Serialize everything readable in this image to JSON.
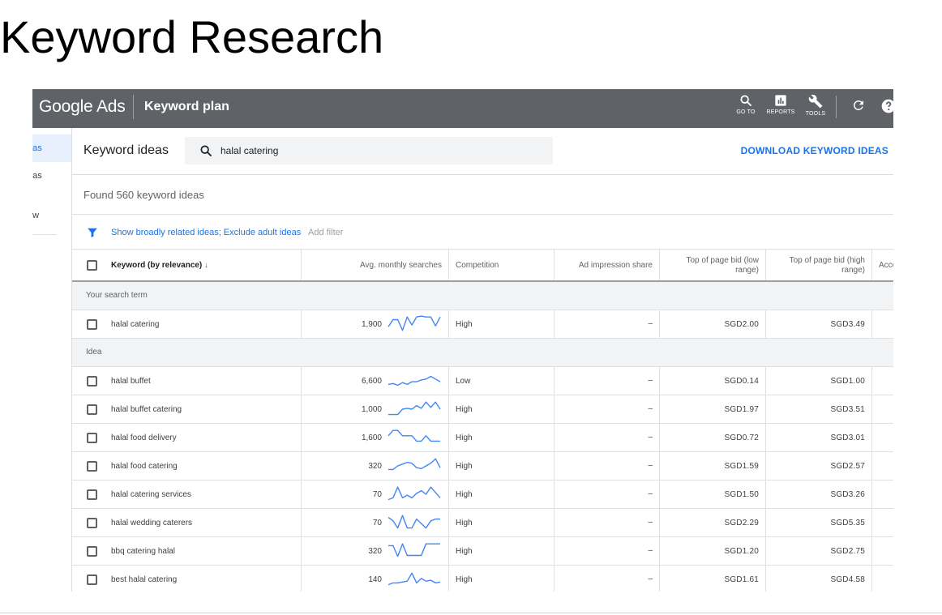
{
  "slide": {
    "title": "Keyword Research"
  },
  "topbar": {
    "brand": "Google Ads",
    "page": "Keyword plan",
    "buttons": [
      {
        "label": "GO TO",
        "icon": "search-icon"
      },
      {
        "label": "REPORTS",
        "icon": "reports-icon"
      },
      {
        "label": "TOOLS",
        "icon": "wrench-icon"
      }
    ],
    "icons": [
      "refresh-icon",
      "help-icon"
    ]
  },
  "nav": {
    "items": [
      "eas",
      "eas",
      "ew"
    ]
  },
  "header": {
    "title": "Keyword ideas",
    "search_value": "halal catering",
    "download": "DOWNLOAD KEYWORD IDEAS"
  },
  "found": "Found 560 keyword ideas",
  "filters": {
    "links": "Show broadly related ideas; Exclude adult ideas",
    "add": "Add filter"
  },
  "table": {
    "columns": {
      "keyword": "Keyword (by relevance)",
      "avg": "Avg. monthly searches",
      "competition": "Competition",
      "impression": "Ad impression share",
      "low_1": "Top of page bid (low",
      "low_2": "range)",
      "high_1": "Top of page bid (high",
      "high_2": "range)",
      "acc": "Acco"
    },
    "groups": {
      "search": "Your search term",
      "idea": "Idea"
    },
    "search_rows": [
      {
        "keyword": "halal catering",
        "searches": "1,900",
        "competition": "High",
        "impression": "–",
        "low": "SGD2.00",
        "high": "SGD3.49",
        "trend": [
          0.35,
          0.75,
          0.75,
          0.15,
          0.9,
          0.45,
          0.9,
          0.95,
          0.9,
          0.9,
          0.4,
          0.9
        ]
      }
    ],
    "idea_rows": [
      {
        "keyword": "halal buffet",
        "searches": "6,600",
        "competition": "Low",
        "impression": "–",
        "low": "SGD0.14",
        "high": "SGD1.00",
        "trend": [
          0.3,
          0.35,
          0.25,
          0.4,
          0.3,
          0.45,
          0.45,
          0.55,
          0.6,
          0.75,
          0.6,
          0.45
        ]
      },
      {
        "keyword": "halal buffet catering",
        "searches": "1,000",
        "competition": "High",
        "impression": "–",
        "low": "SGD1.97",
        "high": "SGD3.51",
        "trend": [
          0.2,
          0.2,
          0.2,
          0.5,
          0.55,
          0.5,
          0.7,
          0.55,
          0.9,
          0.6,
          0.9,
          0.5
        ]
      },
      {
        "keyword": "halal food delivery",
        "searches": "1,600",
        "competition": "High",
        "impression": "–",
        "low": "SGD0.72",
        "high": "SGD3.01",
        "trend": [
          0.6,
          0.9,
          0.9,
          0.6,
          0.6,
          0.6,
          0.3,
          0.3,
          0.6,
          0.3,
          0.3,
          0.3
        ]
      },
      {
        "keyword": "halal food catering",
        "searches": "320",
        "competition": "High",
        "impression": "–",
        "low": "SGD1.59",
        "high": "SGD2.57",
        "trend": [
          0.3,
          0.3,
          0.5,
          0.6,
          0.7,
          0.65,
          0.4,
          0.35,
          0.5,
          0.65,
          0.9,
          0.4
        ]
      },
      {
        "keyword": "halal catering services",
        "searches": "70",
        "competition": "High",
        "impression": "–",
        "low": "SGD1.50",
        "high": "SGD3.26",
        "trend": [
          0.2,
          0.3,
          0.9,
          0.3,
          0.45,
          0.3,
          0.55,
          0.7,
          0.5,
          0.9,
          0.6,
          0.3
        ]
      },
      {
        "keyword": "halal wedding caterers",
        "searches": "70",
        "competition": "High",
        "impression": "–",
        "low": "SGD2.29",
        "high": "SGD5.35",
        "trend": [
          0.8,
          0.6,
          0.2,
          0.9,
          0.2,
          0.2,
          0.7,
          0.45,
          0.2,
          0.6,
          0.7,
          0.7
        ]
      },
      {
        "keyword": "bbq catering halal",
        "searches": "320",
        "competition": "High",
        "impression": "–",
        "low": "SGD1.20",
        "high": "SGD2.75",
        "trend": [
          0.8,
          0.8,
          0.2,
          0.9,
          0.25,
          0.25,
          0.25,
          0.25,
          0.9,
          0.9,
          0.9,
          0.9
        ]
      },
      {
        "keyword": "best halal catering",
        "searches": "140",
        "competition": "High",
        "impression": "–",
        "low": "SGD1.61",
        "high": "SGD4.58",
        "trend": [
          0.2,
          0.3,
          0.3,
          0.35,
          0.4,
          0.85,
          0.3,
          0.55,
          0.4,
          0.45,
          0.3,
          0.35
        ]
      }
    ]
  },
  "colors": {
    "accent": "#1a73e8",
    "topbar": "#5f6368",
    "spark": "#4285f4"
  }
}
